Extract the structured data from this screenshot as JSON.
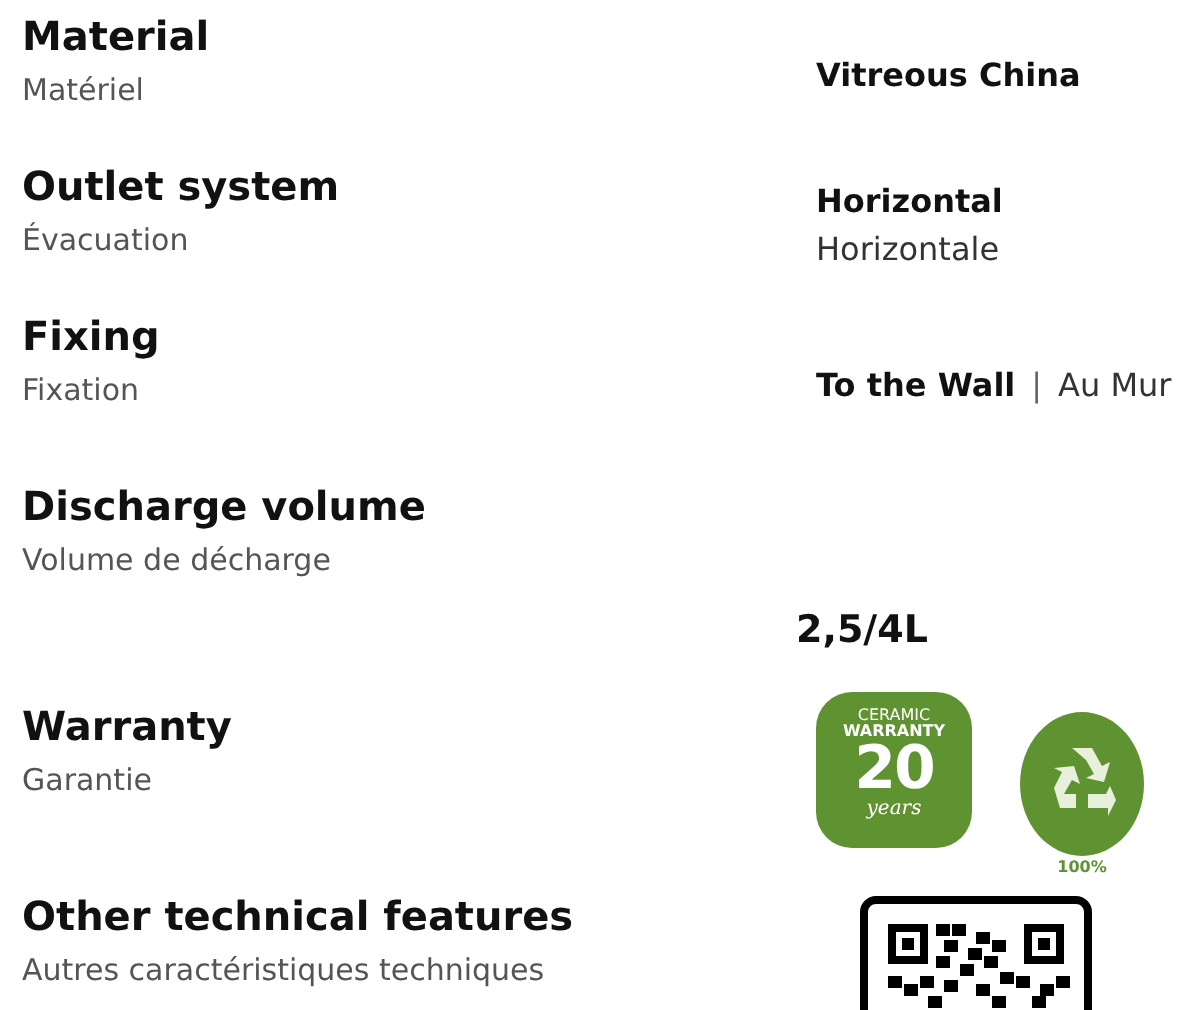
{
  "specs": [
    {
      "label": "Material",
      "sublabel": "Matériel",
      "value": {
        "kind": "text",
        "main": "Vitreous China"
      }
    },
    {
      "label": "Outlet system",
      "sublabel": "Évacuation",
      "value": {
        "kind": "text",
        "main": "Horizontal",
        "sub": "Horizontale"
      }
    },
    {
      "label": "Fixing",
      "sublabel": "Fixation",
      "value": {
        "kind": "inline",
        "main": "To the Wall",
        "separator": "|",
        "sub": "Au Mur"
      }
    },
    {
      "label": "Discharge volume",
      "sublabel": "Volume de décharge",
      "value": {
        "kind": "large",
        "main": "2,5/4L"
      }
    },
    {
      "label": "Warranty",
      "sublabel": "Garantie",
      "value": {
        "kind": "badges",
        "warranty": {
          "top": "CERAMIC",
          "title": "WARRANTY",
          "years": "20",
          "unit": "years"
        },
        "recycle": {
          "caption": "100%"
        }
      }
    },
    {
      "label": "Other technical features",
      "sublabel": "Autres caractéristiques techniques",
      "value": {
        "kind": "qr"
      }
    }
  ]
}
